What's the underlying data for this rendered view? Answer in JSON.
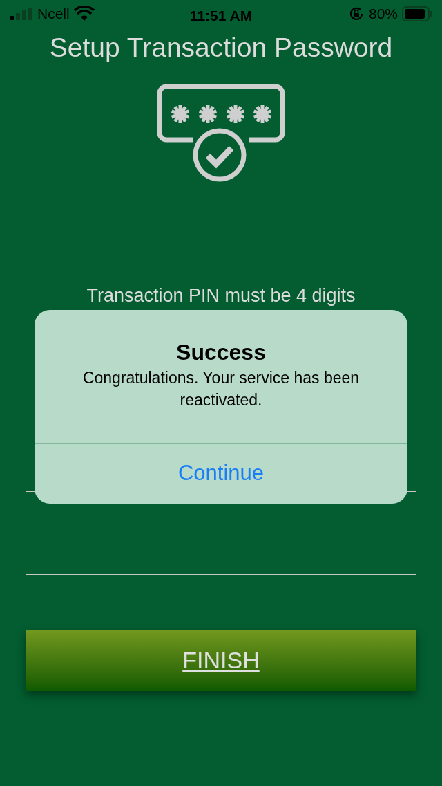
{
  "status_bar": {
    "carrier": "Ncell",
    "time": "11:51 AM",
    "battery": "80%"
  },
  "title": "Setup Transaction Password",
  "hint": "Transaction PIN must be 4 digits",
  "finish_button": "FINISH",
  "alert": {
    "title": "Success",
    "message": "Congratulations. Your service has been reactivated.",
    "button": "Continue"
  }
}
